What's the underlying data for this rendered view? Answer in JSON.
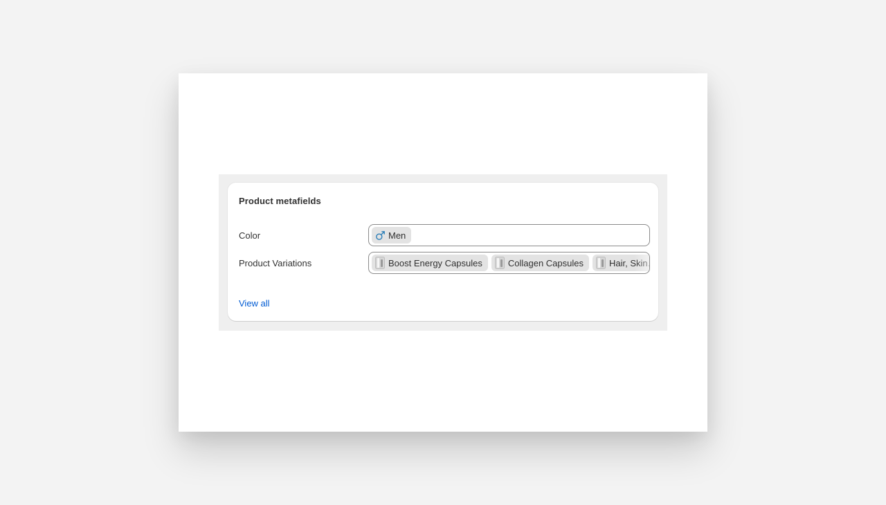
{
  "card": {
    "title": "Product metafields",
    "view_all_label": "View all"
  },
  "fields": {
    "color": {
      "label": "Color",
      "tags": [
        {
          "label": "Men",
          "icon": "male-symbol-icon",
          "icon_color": "#2c7fb8"
        }
      ]
    },
    "variations": {
      "label": "Product Variations",
      "tags": [
        {
          "label": "Boost Energy Capsules",
          "icon": "product-thumbnail-icon"
        },
        {
          "label": "Collagen Capsules",
          "icon": "product-thumbnail-icon"
        },
        {
          "label": "Hair, Skin…",
          "icon": "product-thumbnail-icon"
        }
      ]
    }
  },
  "colors": {
    "page_background": "#f3f3f3",
    "backdrop": "#efefef",
    "card": "#ffffff",
    "tag_background": "#e3e3e3",
    "field_border": "#8a8a8a",
    "link": "#005bd3",
    "text": "#303030"
  }
}
